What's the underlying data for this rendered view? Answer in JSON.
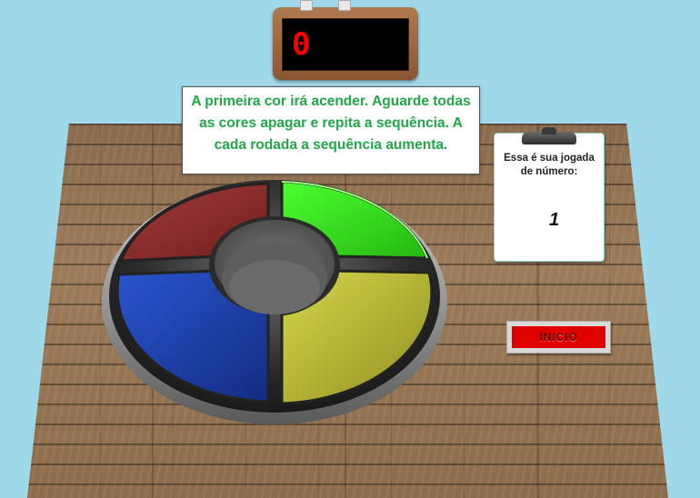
{
  "scoreboard": {
    "value": "0"
  },
  "instructions": {
    "text": "A primeira cor irá acender. Aguarde todas as cores apagar e repita a sequência. A cada rodada a sequência aumenta."
  },
  "clipboard": {
    "label": "Essa é sua jogada de número:",
    "round": "1"
  },
  "start_button": {
    "label": "INICIO"
  },
  "pads": [
    {
      "name": "red",
      "color": "#8e2b2b",
      "lit": false
    },
    {
      "name": "green",
      "color": "#3ee81e",
      "lit": true
    },
    {
      "name": "blue",
      "color": "#1f46b8",
      "lit": false
    },
    {
      "name": "yellow",
      "color": "#c2c23e",
      "lit": false
    }
  ],
  "colors": {
    "sky": "#9fd8e8",
    "instruction_text": "#1fa845",
    "score_digit": "#ff0000",
    "start_button": "#e00000"
  }
}
